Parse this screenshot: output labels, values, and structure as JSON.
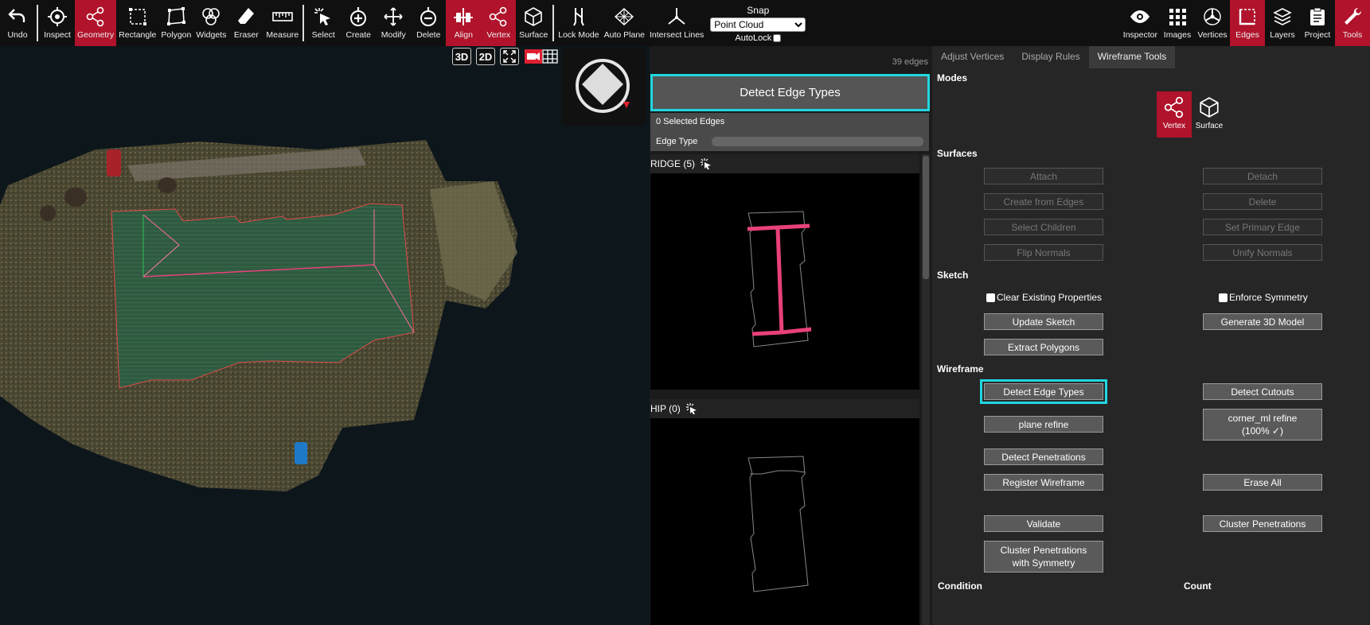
{
  "toolbar": {
    "left": [
      {
        "label": "Undo",
        "icon": "undo-icon",
        "active": false
      },
      {
        "label": "Inspect",
        "icon": "crosshair-icon",
        "active": false
      },
      {
        "label": "Geometry",
        "icon": "share-nodes-icon",
        "active": true
      },
      {
        "label": "Rectangle",
        "icon": "rectangle-icon",
        "active": false
      },
      {
        "label": "Polygon",
        "icon": "polygon-icon",
        "active": false
      },
      {
        "label": "Widgets",
        "icon": "widgets-icon",
        "active": false
      },
      {
        "label": "Eraser",
        "icon": "eraser-icon",
        "active": false
      },
      {
        "label": "Measure",
        "icon": "ruler-icon",
        "active": false
      },
      {
        "label": "Select",
        "icon": "select-cursor-icon",
        "active": false
      },
      {
        "label": "Create",
        "icon": "plus-circle-icon",
        "active": false
      },
      {
        "label": "Modify",
        "icon": "move-arrows-icon",
        "active": false
      },
      {
        "label": "Delete",
        "icon": "minus-circle-icon",
        "active": false
      },
      {
        "label": "Align",
        "icon": "align-icon",
        "active": true
      },
      {
        "label": "Vertex",
        "icon": "share-nodes-icon",
        "active": true
      },
      {
        "label": "Surface",
        "icon": "cube-icon",
        "active": false
      },
      {
        "label": "Lock Mode",
        "icon": "lock-mode-icon",
        "active": false
      },
      {
        "label": "Auto Plane",
        "icon": "auto-plane-icon",
        "active": false
      },
      {
        "label": "Intersect Lines",
        "icon": "intersect-lines-icon",
        "active": false
      }
    ],
    "snap": {
      "title": "Snap",
      "value": "Point Cloud",
      "autolock": "AutoLock"
    },
    "right": [
      {
        "label": "Inspector",
        "icon": "eye-icon",
        "active": false
      },
      {
        "label": "Images",
        "icon": "grid-dots-icon",
        "active": false
      },
      {
        "label": "Vertices",
        "icon": "vertices-icon",
        "active": false
      },
      {
        "label": "Edges",
        "icon": "edges-icon",
        "active": true
      },
      {
        "label": "Layers",
        "icon": "layers-icon",
        "active": false
      },
      {
        "label": "Project",
        "icon": "clipboard-icon",
        "active": false
      },
      {
        "label": "Tools",
        "icon": "wrench-icon",
        "active": true
      }
    ]
  },
  "viewport": {
    "buttons": {
      "b3d": "3D",
      "b2d": "2D"
    }
  },
  "edges_panel": {
    "count": "39 edges",
    "detect_button": "Detect Edge Types",
    "selected": "0 Selected Edges",
    "edge_type_label": "Edge Type",
    "ridge_label": "RIDGE (5)",
    "hip_label": "HIP (0)"
  },
  "tools_panel": {
    "tabs": [
      "Adjust Vertices",
      "Display Rules",
      "Wireframe Tools"
    ],
    "active_tab": 2,
    "modes_title": "Modes",
    "mode_vertex": "Vertex",
    "mode_surface": "Surface",
    "surfaces_title": "Surfaces",
    "surfaces": {
      "attach": "Attach",
      "detach": "Detach",
      "create_from_edges": "Create from Edges",
      "delete": "Delete",
      "select_children": "Select Children",
      "set_primary_edge": "Set Primary Edge",
      "flip_normals": "Flip Normals",
      "unify_normals": "Unify Normals"
    },
    "sketch_title": "Sketch",
    "sketch": {
      "clear_existing": "Clear Existing Properties",
      "enforce_symmetry": "Enforce Symmetry",
      "update_sketch": "Update Sketch",
      "generate_3d": "Generate 3D Model",
      "extract_polygons": "Extract Polygons"
    },
    "wireframe_title": "Wireframe",
    "wireframe": {
      "detect_edge_types": "Detect Edge Types",
      "detect_cutouts": "Detect Cutouts",
      "plane_refine": "plane refine",
      "corner_ml_refine_1": "corner_ml refine",
      "corner_ml_refine_2": "(100% ✓)",
      "detect_penetrations": "Detect Penetrations",
      "register_wireframe": "Register Wireframe",
      "erase_all": "Erase All",
      "validate": "Validate",
      "cluster_penetrations": "Cluster Penetrations",
      "cluster_sym_1": "Cluster Penetrations",
      "cluster_sym_2": "with Symmetry"
    },
    "condition_header": "Condition",
    "count_header": "Count"
  },
  "colors": {
    "accent_red": "#b0132b",
    "highlight_cyan": "#21d6e0",
    "ridge_pink": "#e8417a"
  }
}
